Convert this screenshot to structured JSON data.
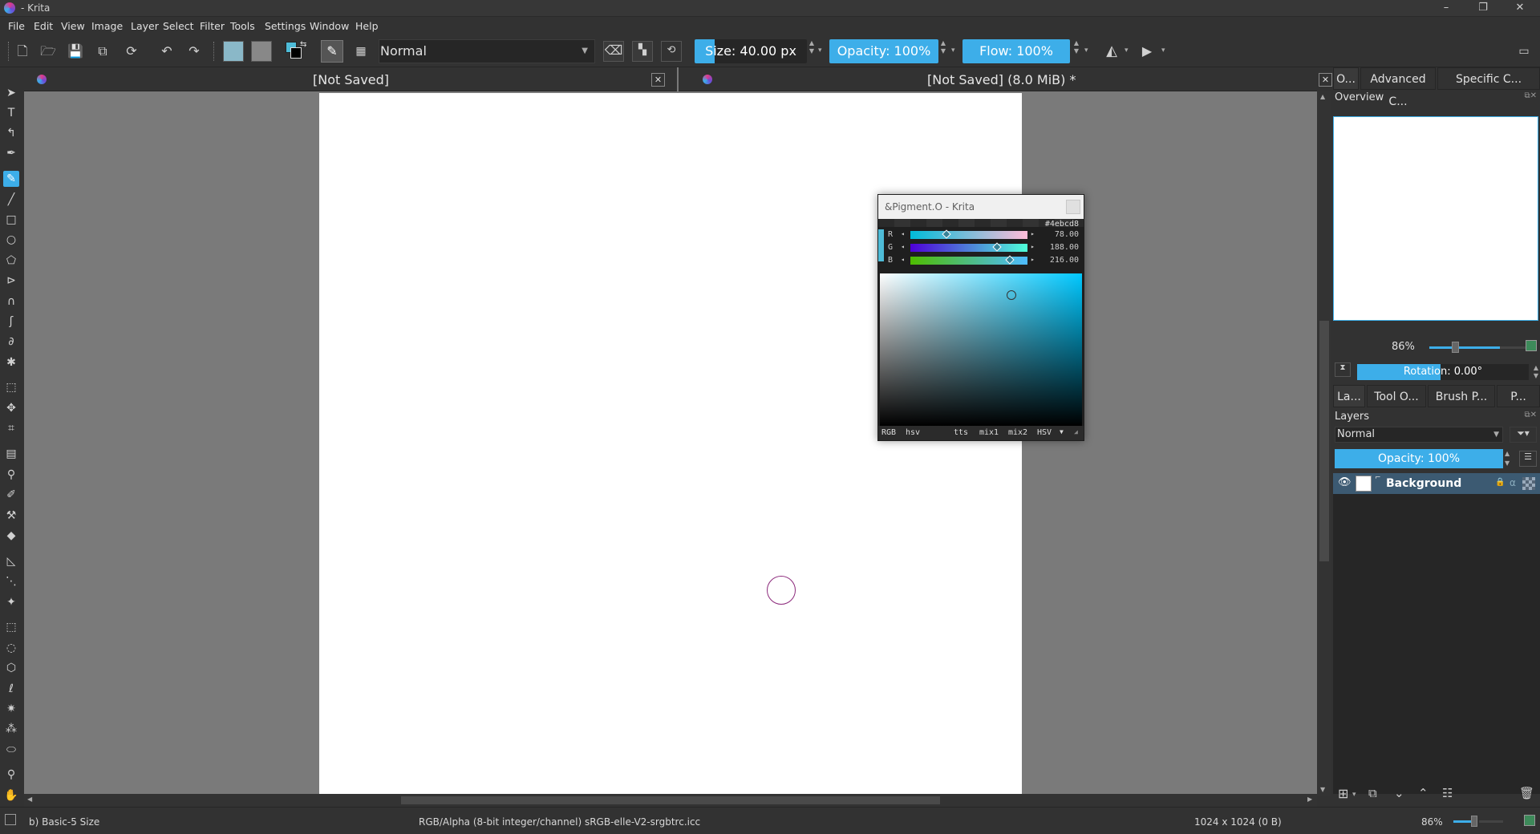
{
  "window": {
    "title": "- Krita",
    "minimize": "–",
    "restore": "❐",
    "close": "✕"
  },
  "menu": [
    "File",
    "Edit",
    "View",
    "Image",
    "Layer",
    "Select",
    "Filter",
    "Tools",
    "Settings",
    "Window",
    "Help"
  ],
  "toolbar": {
    "blend_mode": "Normal",
    "size": "Size: 40.00 px",
    "opacity": "Opacity: 100%",
    "flow": "Flow: 100%"
  },
  "documents": [
    {
      "title": "[Not Saved]",
      "close": "✕"
    },
    {
      "title": "[Not Saved]  (8.0 MiB) *",
      "close": "✕"
    }
  ],
  "pigment": {
    "title": "&Pigment.O - Krita",
    "hex": "#4ebcd8",
    "channels": [
      {
        "label": "R",
        "value": "78.00",
        "fraction": 0.306
      },
      {
        "label": "G",
        "value": "188.00",
        "fraction": 0.737
      },
      {
        "label": "B",
        "value": "216.00",
        "fraction": 0.847
      }
    ],
    "footer": {
      "left1": "RGB",
      "left2": "hsv",
      "right1": "tts",
      "right2": "mix1",
      "right3": "mix2",
      "right4": "HSV"
    },
    "accent": "#4ebcd8"
  },
  "dock": {
    "tabs_top": [
      "O...",
      "Advanced C...",
      "Specific C..."
    ],
    "overview_title": "Overview",
    "zoom": "86%",
    "rotation": "Rotation: 0.00°",
    "tabs_mid": [
      "La...",
      "Tool O...",
      "Brush P...",
      "P..."
    ],
    "layers_title": "Layers",
    "layer_blend": "Normal",
    "layer_opacity": "Opacity:  100%",
    "layer_name": "Background"
  },
  "status": {
    "brush": "b) Basic-5 Size",
    "color_space": "RGB/Alpha (8-bit integer/channel)  sRGB-elle-V2-srgbtrc.icc",
    "dimensions": "1024 x 1024 (0 B)",
    "zoom": "86%"
  },
  "colors": {
    "accent": "#3daee9",
    "foreground": "#4ebcd8",
    "background": "#000000"
  }
}
